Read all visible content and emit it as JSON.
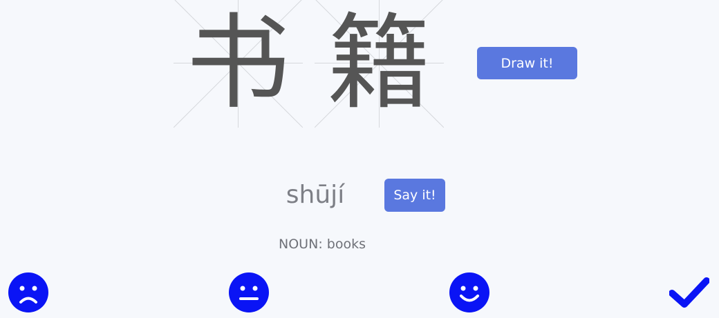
{
  "word": {
    "characters": [
      {
        "glyph": "书"
      },
      {
        "glyph": "籍"
      }
    ],
    "pinyin": "shūjí",
    "definition": {
      "part_of_speech": "NOUN",
      "separator": ": ",
      "meaning": "books"
    }
  },
  "buttons": {
    "draw_label": "Draw it!",
    "say_label": "Say it!"
  },
  "ratings": [
    {
      "icon": "frown-face-icon"
    },
    {
      "icon": "neutral-face-icon"
    },
    {
      "icon": "smile-face-icon"
    },
    {
      "icon": "checkmark-icon"
    }
  ],
  "colors": {
    "background": "#f6f8fc",
    "button": "#5a78df",
    "rating_icon": "#0a14f5",
    "character": "#555555",
    "highlight_stroke": "#3f7fc0",
    "grid_lines": "#d6d8dc"
  }
}
